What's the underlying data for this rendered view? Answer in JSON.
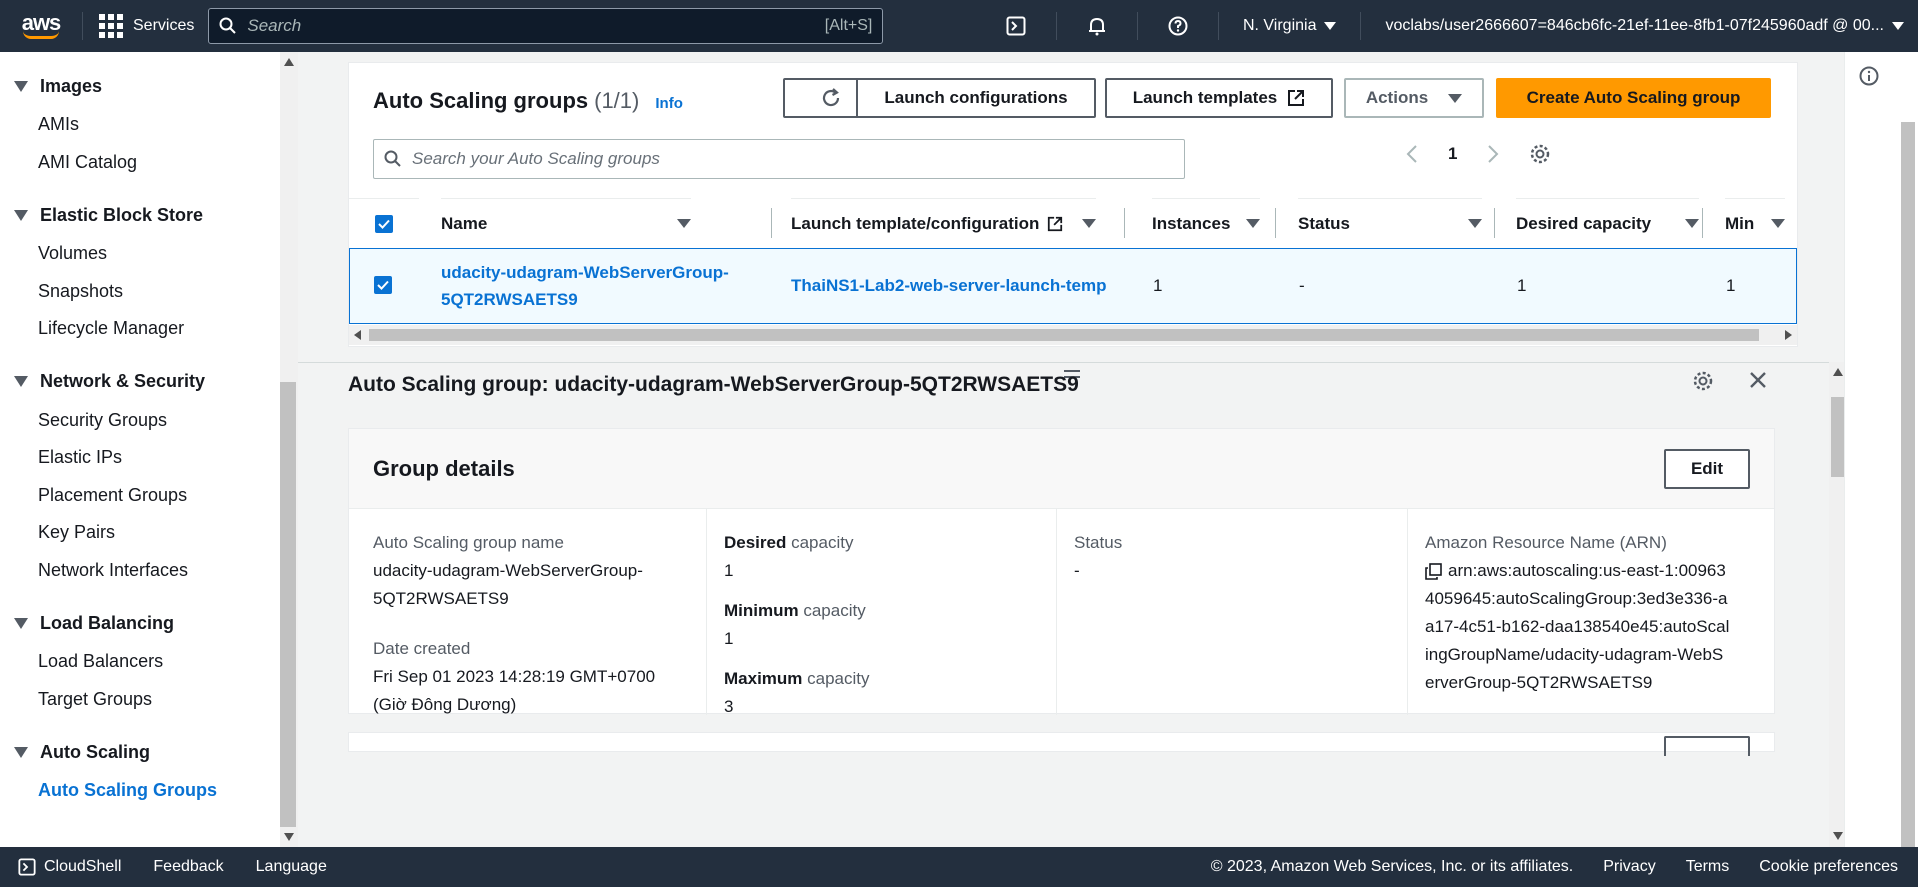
{
  "topbar": {
    "logo": "aws",
    "services": "Services",
    "search_placeholder": "Search",
    "search_shortcut": "[Alt+S]",
    "region": "N. Virginia",
    "user": "voclabs/user2666607=846cb6fc-21ef-11ee-8fb1-07f245960adf @ 00..."
  },
  "sidebar": {
    "sections": [
      {
        "title": "Images",
        "items": [
          "AMIs",
          "AMI Catalog"
        ]
      },
      {
        "title": "Elastic Block Store",
        "items": [
          "Volumes",
          "Snapshots",
          "Lifecycle Manager"
        ]
      },
      {
        "title": "Network & Security",
        "items": [
          "Security Groups",
          "Elastic IPs",
          "Placement Groups",
          "Key Pairs",
          "Network Interfaces"
        ]
      },
      {
        "title": "Load Balancing",
        "items": [
          "Load Balancers",
          "Target Groups"
        ]
      },
      {
        "title": "Auto Scaling",
        "items": [
          "Auto Scaling Groups"
        ]
      }
    ],
    "active_item": "Auto Scaling Groups"
  },
  "table": {
    "title": "Auto Scaling groups",
    "count": "(1/1)",
    "info": "Info",
    "buttons": {
      "launch_configurations": "Launch configurations",
      "launch_templates": "Launch templates",
      "actions": "Actions",
      "create": "Create Auto Scaling group"
    },
    "search_placeholder": "Search your Auto Scaling groups",
    "page": "1",
    "columns": [
      "Name",
      "Launch template/configuration",
      "Instances",
      "Status",
      "Desired capacity",
      "Min"
    ],
    "rows": [
      {
        "name_line1": "udacity-udagram-WebServerGroup-",
        "name_line2": "5QT2RWSAETS9",
        "launch_template": "ThaiNS1-Lab2-web-server-launch-temp",
        "instances": "1",
        "status": "-",
        "desired": "1",
        "min": "1"
      }
    ]
  },
  "detail": {
    "title": "Auto Scaling group: udacity-udagram-WebServerGroup-5QT2RWSAETS9",
    "card_title": "Group details",
    "edit": "Edit",
    "asg_name_label": "Auto Scaling group name",
    "asg_name_line1": "udacity-udagram-WebServerGroup-",
    "asg_name_line2": "5QT2RWSAETS9",
    "date_label": "Date created",
    "date_line1": "Fri Sep 01 2023 14:28:19 GMT+0700",
    "date_line2": "(Giờ Đông Dương)",
    "desired_bold": "Desired",
    "desired_rest": " capacity",
    "desired_value": "1",
    "min_bold": "Minimum",
    "min_rest": " capacity",
    "min_value": "1",
    "max_bold": "Maximum",
    "max_rest": " capacity",
    "max_value": "3",
    "status_label": "Status",
    "status_value": "-",
    "arn_label": "Amazon Resource Name (ARN)",
    "arn_lines": [
      "arn:aws:autoscaling:us-east-1:00963",
      "4059645:autoScalingGroup:3ed3e336-a",
      "a17-4c51-b162-daa138540e45:autoScal",
      "ingGroupName/udacity-udagram-WebS",
      "erverGroup-5QT2RWSAETS9"
    ]
  },
  "footer": {
    "cloudshell": "CloudShell",
    "feedback": "Feedback",
    "language": "Language",
    "copyright": "© 2023, Amazon Web Services, Inc. or its affiliates.",
    "privacy": "Privacy",
    "terms": "Terms",
    "cookie": "Cookie preferences"
  },
  "colors": {
    "accent": "#0972d3",
    "primary_button": "#ff9900",
    "topbar": "#232f3e"
  }
}
